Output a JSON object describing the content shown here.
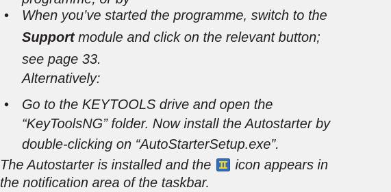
{
  "lines": {
    "l0": "programme, or by",
    "b1_a": "When you’ve started the programme, switch to the",
    "b1_bold": "Support",
    "b1_b": " module and click on the relevant button;",
    "b1_c": "see page 33.",
    "alt": "Alternatively:",
    "b2_a": "Go to the KEYTOOLS drive and open the",
    "b2_b": "“KeyToolsNG” folder. Now install the Autostarter by",
    "b2_c": "double-clicking on “AutoStarterSetup.exe”.",
    "end_a1": "The Autostarter is installed and the ",
    "end_a2": " icon appears in",
    "end_b": "the notification area of the taskbar."
  },
  "icons": {
    "autostarter": "autostarter-tray-icon"
  },
  "colors": {
    "background": "#f1f1f2",
    "text": "#231f20",
    "icon_fill": "#2f6fc2",
    "icon_glyph": "#f4d21f"
  }
}
